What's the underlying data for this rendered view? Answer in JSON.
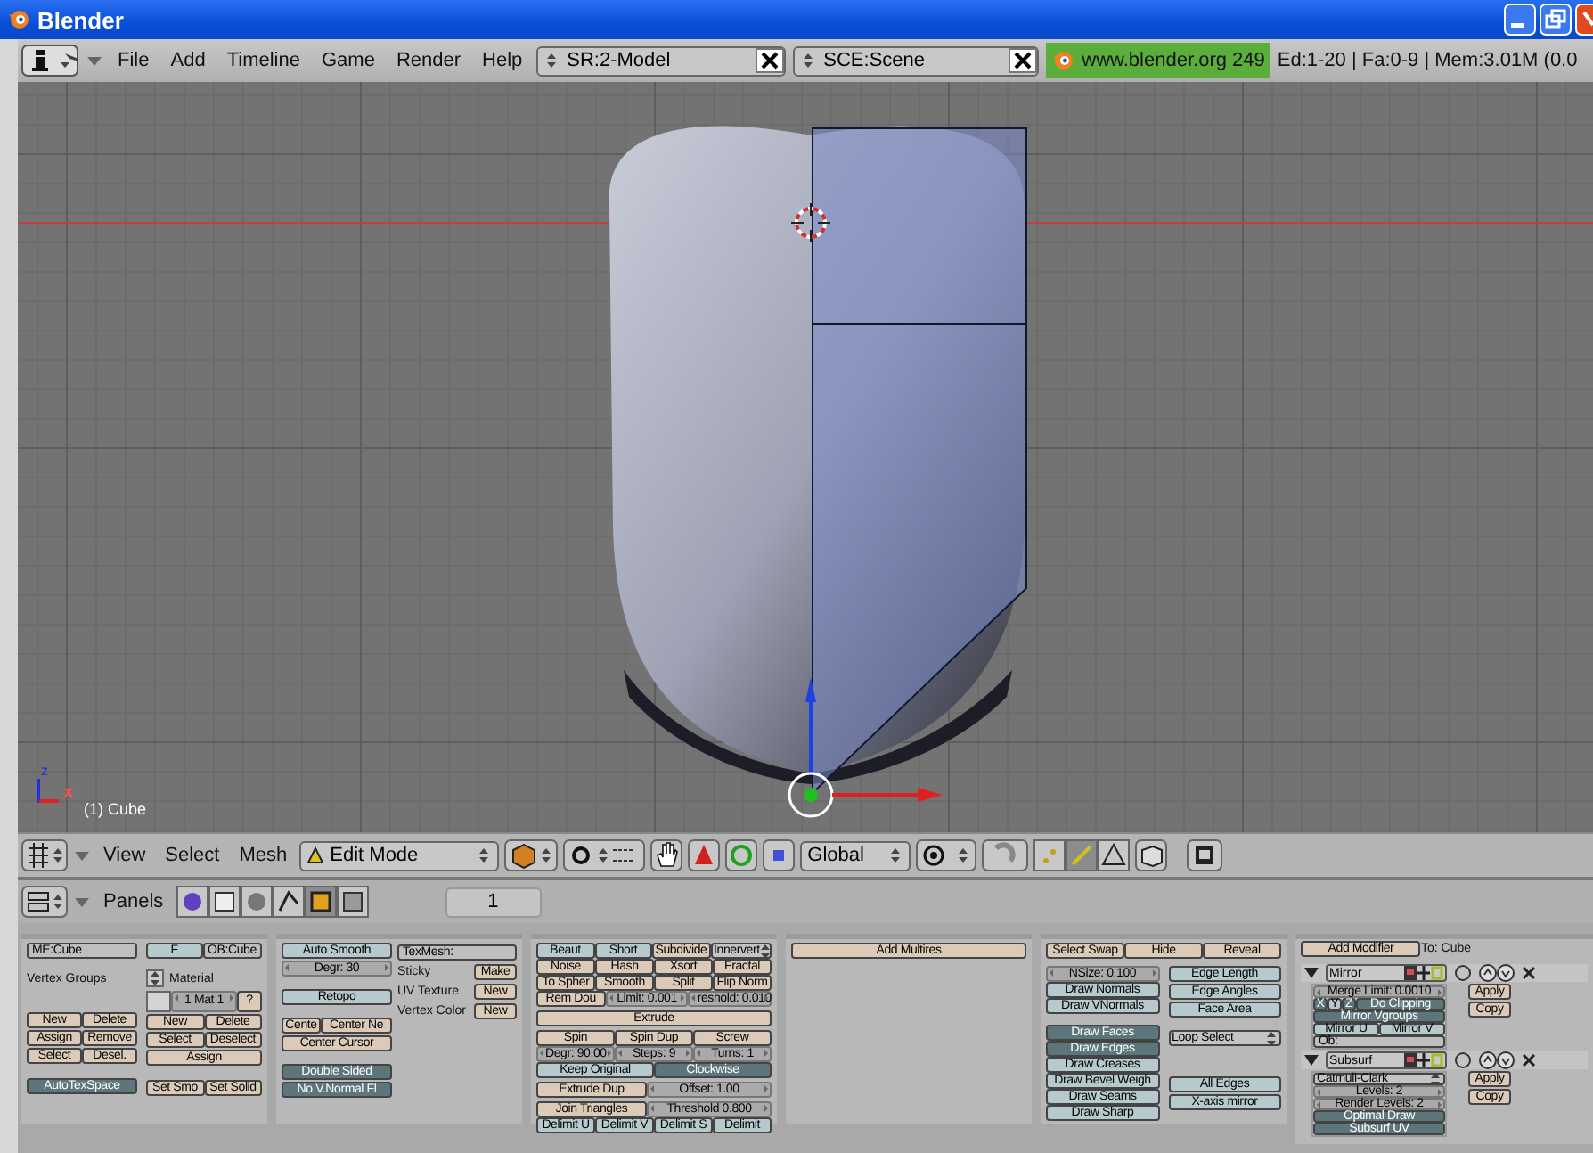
{
  "window": {
    "title": "Blender"
  },
  "info_header": {
    "menus": [
      "File",
      "Add",
      "Timeline",
      "Game",
      "Render",
      "Help"
    ],
    "screen": "SR:2-Model",
    "scene": "SCE:Scene",
    "version": "www.blender.org 249",
    "stats": "Ed:1-20 | Fa:0-9 | Mem:3.01M (0.0"
  },
  "viewport": {
    "object_label": "(1) Cube",
    "axis_labels": [
      "z",
      "x"
    ]
  },
  "view_header": {
    "menus": [
      "View",
      "Select",
      "Mesh"
    ],
    "mode": "Edit Mode",
    "orientation": "Global",
    "select_modes": [
      {
        "kind": "vertex",
        "selected": false
      },
      {
        "kind": "edge",
        "selected": true
      },
      {
        "kind": "face",
        "selected": false
      }
    ]
  },
  "buttons_header": {
    "label": "Panels",
    "page": "1"
  },
  "panels": [
    {
      "kind": "buttons",
      "columns": [
        [
          [
            {
              "kind": "field",
              "label": "ME:Cube"
            }
          ],
          [
            {
              "kind": "label",
              "label": "Vertex Groups"
            }
          ],
          [
            {
              "kind": "button",
              "label": "New"
            },
            {
              "kind": "button",
              "label": "Delete"
            }
          ],
          [
            {
              "kind": "button",
              "label": "Assign"
            },
            {
              "kind": "button",
              "label": "Remove"
            }
          ],
          [
            {
              "kind": "button",
              "label": "Select"
            },
            {
              "kind": "button",
              "label": "Desel."
            }
          ],
          [
            {
              "kind": "toggle",
              "label": "AutoTexSpace",
              "on": true
            }
          ]
        ],
        [
          [
            {
              "kind": "toggle",
              "label": "F",
              "on": false
            },
            {
              "kind": "field",
              "label": "OB:Cube"
            }
          ],
          [
            {
              "kind": "menuicon"
            },
            {
              "kind": "label",
              "label": "Material"
            }
          ],
          [
            {
              "kind": "swatch"
            },
            {
              "kind": "number",
              "label": "1 Mat 1"
            },
            {
              "kind": "button",
              "label": "?"
            }
          ],
          [
            {
              "kind": "button",
              "label": "New"
            },
            {
              "kind": "button",
              "label": "Delete"
            }
          ],
          [
            {
              "kind": "button",
              "label": "Select"
            },
            {
              "kind": "button",
              "label": "Deselect"
            }
          ],
          [
            {
              "kind": "button",
              "label": "Assign"
            }
          ],
          [
            {
              "kind": "button",
              "label": "Set Smo"
            },
            {
              "kind": "button",
              "label": "Set Solid"
            }
          ]
        ]
      ]
    },
    {
      "kind": "buttons",
      "columns": [
        [
          [
            {
              "kind": "toggle",
              "label": "Auto Smooth",
              "on": false
            }
          ],
          [
            {
              "kind": "number",
              "label": "Degr: 30"
            }
          ],
          [
            {
              "kind": "toggle",
              "label": "Retopo",
              "on": false
            }
          ],
          [
            {
              "kind": "button",
              "label": "Cente"
            },
            {
              "kind": "button",
              "label": "Center Ne"
            }
          ],
          [
            {
              "kind": "button",
              "label": "Center Cursor"
            }
          ],
          [
            {
              "kind": "toggle",
              "label": "Double Sided",
              "on": true
            }
          ],
          [
            {
              "kind": "toggle",
              "label": "No V.Normal Fl",
              "on": true
            }
          ]
        ],
        [
          [
            {
              "kind": "field",
              "label": "TexMesh:"
            }
          ],
          [
            {
              "kind": "label",
              "label": "Sticky"
            },
            {
              "kind": "button",
              "label": "Make"
            }
          ],
          [
            {
              "kind": "label",
              "label": "UV Texture"
            },
            {
              "kind": "button",
              "label": "New"
            }
          ],
          [
            {
              "kind": "label",
              "label": "Vertex Color"
            },
            {
              "kind": "button",
              "label": "New"
            }
          ]
        ]
      ]
    },
    {
      "kind": "buttons",
      "columns": [
        [
          [
            {
              "kind": "toggle",
              "label": "Beaut",
              "on": false
            },
            {
              "kind": "toggle",
              "label": "Short",
              "on": false
            },
            {
              "kind": "button",
              "label": "Subdivide"
            },
            {
              "kind": "menu",
              "label": "Innervert"
            }
          ],
          [
            {
              "kind": "button",
              "label": "Noise"
            },
            {
              "kind": "button",
              "label": "Hash"
            },
            {
              "kind": "button",
              "label": "Xsort"
            },
            {
              "kind": "button",
              "label": "Fractal"
            }
          ],
          [
            {
              "kind": "button",
              "label": "To Spher"
            },
            {
              "kind": "button",
              "label": "Smooth"
            },
            {
              "kind": "button",
              "label": "Split"
            },
            {
              "kind": "button",
              "label": "Flip Norm"
            }
          ],
          [
            {
              "kind": "button",
              "label": "Rem Dou"
            },
            {
              "kind": "number",
              "label": "Limit: 0.001"
            },
            {
              "kind": "number",
              "label": "reshold: 0.010"
            }
          ],
          [
            {
              "kind": "button",
              "label": "Extrude"
            }
          ],
          [
            {
              "kind": "button",
              "label": "Spin"
            },
            {
              "kind": "button",
              "label": "Spin Dup"
            },
            {
              "kind": "button",
              "label": "Screw"
            }
          ],
          [
            {
              "kind": "number",
              "label": "Degr: 90.00"
            },
            {
              "kind": "number",
              "label": "Steps: 9"
            },
            {
              "kind": "number",
              "label": "Turns: 1"
            }
          ],
          [
            {
              "kind": "toggle",
              "label": "Keep Original",
              "on": false
            },
            {
              "kind": "toggle",
              "label": "Clockwise",
              "on": true
            }
          ],
          [
            {
              "kind": "button",
              "label": "Extrude Dup"
            },
            {
              "kind": "number",
              "label": "Offset: 1.00"
            }
          ],
          [
            {
              "kind": "button",
              "label": "Join Triangles"
            },
            {
              "kind": "number",
              "label": "Threshold 0.800"
            }
          ],
          [
            {
              "kind": "toggle",
              "label": "Delimit U",
              "on": false
            },
            {
              "kind": "toggle",
              "label": "Delimit V",
              "on": false
            },
            {
              "kind": "toggle",
              "label": "Delimit S",
              "on": false
            },
            {
              "kind": "toggle",
              "label": "Delimit",
              "on": false
            }
          ]
        ]
      ]
    },
    {
      "kind": "buttons",
      "columns": [
        [
          [
            {
              "kind": "button",
              "label": "Add Multires"
            }
          ]
        ]
      ]
    },
    {
      "kind": "buttons",
      "top": [
        {
          "kind": "button",
          "label": "Select Swap"
        },
        {
          "kind": "button",
          "label": "Hide"
        },
        {
          "kind": "button",
          "label": "Reveal"
        }
      ],
      "columns": [
        [
          [
            {
              "kind": "number",
              "label": "NSize: 0.100"
            }
          ],
          [
            {
              "kind": "toggle",
              "label": "Draw Normals",
              "on": false
            }
          ],
          [
            {
              "kind": "toggle",
              "label": "Draw VNormals",
              "on": false
            }
          ],
          [
            {
              "kind": "toggle",
              "label": "Draw Faces",
              "on": true
            }
          ],
          [
            {
              "kind": "toggle",
              "label": "Draw Edges",
              "on": true
            }
          ],
          [
            {
              "kind": "toggle",
              "label": "Draw Creases",
              "on": false
            }
          ],
          [
            {
              "kind": "toggle",
              "label": "Draw Bevel Weigh",
              "on": false
            }
          ],
          [
            {
              "kind": "toggle",
              "label": "Draw Seams",
              "on": false
            }
          ],
          [
            {
              "kind": "toggle",
              "label": "Draw Sharp",
              "on": false
            }
          ]
        ],
        [
          [
            {
              "kind": "toggle",
              "label": "Edge Length",
              "on": false
            }
          ],
          [
            {
              "kind": "toggle",
              "label": "Edge Angles",
              "on": false
            }
          ],
          [
            {
              "kind": "toggle",
              "label": "Face Area",
              "on": false
            }
          ],
          [
            {
              "kind": "menu",
              "label": "Loop Select"
            }
          ],
          [
            {
              "kind": "toggle",
              "label": "All Edges",
              "on": false
            }
          ],
          [
            {
              "kind": "toggle",
              "label": "X-axis mirror",
              "on": false
            }
          ]
        ]
      ]
    },
    {
      "kind": "modifiers",
      "top": [
        {
          "kind": "button",
          "label": "Add Modifier"
        },
        {
          "kind": "label",
          "label": "To: Cube"
        }
      ],
      "modifiers": [
        {
          "name": "Mirror",
          "expanded": true,
          "rows": [
            {
              "controls": [
                {
                  "kind": "number",
                  "label": "Merge Limit: 0.0010"
                }
              ]
            },
            {
              "controls": [
                {
                  "kind": "toggle",
                  "label": "X",
                  "on": true
                },
                {
                  "kind": "toggle",
                  "label": "Y",
                  "on": false
                },
                {
                  "kind": "toggle",
                  "label": "Z",
                  "on": true
                },
                {
                  "kind": "toggle",
                  "label": "Do Clipping",
                  "on": true
                }
              ]
            },
            {
              "controls": [
                {
                  "kind": "toggle",
                  "label": "Mirror Vgroups",
                  "on": true
                }
              ]
            },
            {
              "controls": [
                {
                  "kind": "toggle",
                  "label": "Mirror U",
                  "on": false
                },
                {
                  "kind": "toggle",
                  "label": "Mirror V",
                  "on": false
                }
              ]
            },
            {
              "controls": [
                {
                  "kind": "field",
                  "label": "Ob:"
                }
              ]
            }
          ],
          "actions": [
            "Apply",
            "Copy"
          ]
        },
        {
          "name": "Subsurf",
          "expanded": true,
          "rows": [
            {
              "controls": [
                {
                  "kind": "menu",
                  "label": "Catmull-Clark"
                }
              ]
            },
            {
              "controls": [
                {
                  "kind": "number",
                  "label": "Levels: 2"
                }
              ]
            },
            {
              "controls": [
                {
                  "kind": "number",
                  "label": "Render Levels: 2"
                }
              ]
            },
            {
              "controls": [
                {
                  "kind": "toggle",
                  "label": "Optimal Draw",
                  "on": true
                }
              ]
            },
            {
              "controls": [
                {
                  "kind": "toggle",
                  "label": "Subsurf UV",
                  "on": true
                }
              ]
            }
          ],
          "actions": [
            "Apply",
            "Copy"
          ]
        }
      ]
    }
  ]
}
